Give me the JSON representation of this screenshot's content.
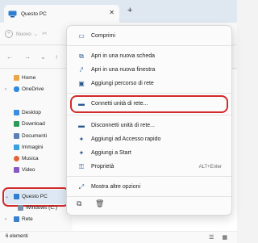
{
  "window": {
    "tab_title": "Questo PC",
    "tab_close": "✕",
    "new_tab": "+"
  },
  "toolbar": {
    "new_label": "Nuovo",
    "new_plus": "+",
    "chevron": "⌄",
    "cut_icon": "✂"
  },
  "nav": {
    "back": "←",
    "forward": "→",
    "down": "⌄",
    "up": "↑"
  },
  "sidebar": {
    "items": [
      {
        "label": "Home",
        "icon": "home-icon",
        "color": "#e8a84a"
      },
      {
        "label": "OneDrive",
        "icon": "onedrive-icon",
        "color": "#2f8be0"
      },
      {
        "label": "Desktop",
        "icon": "desktop-icon",
        "color": "#3a8de0"
      },
      {
        "label": "Download",
        "icon": "download-icon",
        "color": "#2c9a5b"
      },
      {
        "label": "Documenti",
        "icon": "documents-icon",
        "color": "#5a7fb0"
      },
      {
        "label": "Immagini",
        "icon": "pictures-icon",
        "color": "#3ca0e0"
      },
      {
        "label": "Musica",
        "icon": "music-icon",
        "color": "#e0643a"
      },
      {
        "label": "Video",
        "icon": "video-icon",
        "color": "#8a56c2"
      },
      {
        "label": "Questo PC",
        "icon": "this-pc-icon",
        "color": "#2f7fd0"
      },
      {
        "label": "Windows (C:)",
        "icon": "drive-icon",
        "color": "#7a8fa6"
      },
      {
        "label": "Rete",
        "icon": "network-icon",
        "color": "#3a7fd0"
      }
    ],
    "chevron": "›"
  },
  "status": {
    "count": "6 elementi",
    "view_icons": "☰ ▦"
  },
  "context_menu": {
    "items": [
      {
        "label": "Comprimi",
        "icon": "collapse-icon",
        "glyph": "▭"
      },
      {
        "label": "Apri in una nuova scheda",
        "icon": "new-tab-icon",
        "glyph": "⧉"
      },
      {
        "label": "Apri in una nuova finestra",
        "icon": "new-window-icon",
        "glyph": "⤤"
      },
      {
        "label": "Aggiungi percorso di rete",
        "icon": "network-location-icon",
        "glyph": "▣"
      },
      {
        "label": "Connetti unità di rete...",
        "icon": "map-drive-icon",
        "glyph": "▬"
      },
      {
        "label": "Disconnetti unità di rete...",
        "icon": "disconnect-drive-icon",
        "glyph": "▬"
      },
      {
        "label": "Aggiungi ad Accesso rapido",
        "icon": "pin-quick-access-icon",
        "glyph": "✦"
      },
      {
        "label": "Aggiungi a Start",
        "icon": "pin-start-icon",
        "glyph": "✦"
      },
      {
        "label": "Proprietà",
        "icon": "properties-icon",
        "glyph": "⚿",
        "shortcut": "ALT+Enter"
      },
      {
        "label": "Mostra altre opzioni",
        "icon": "more-options-icon",
        "glyph": "⤢"
      }
    ],
    "copy_icon": "⧉",
    "delete_icon": "🗑"
  }
}
